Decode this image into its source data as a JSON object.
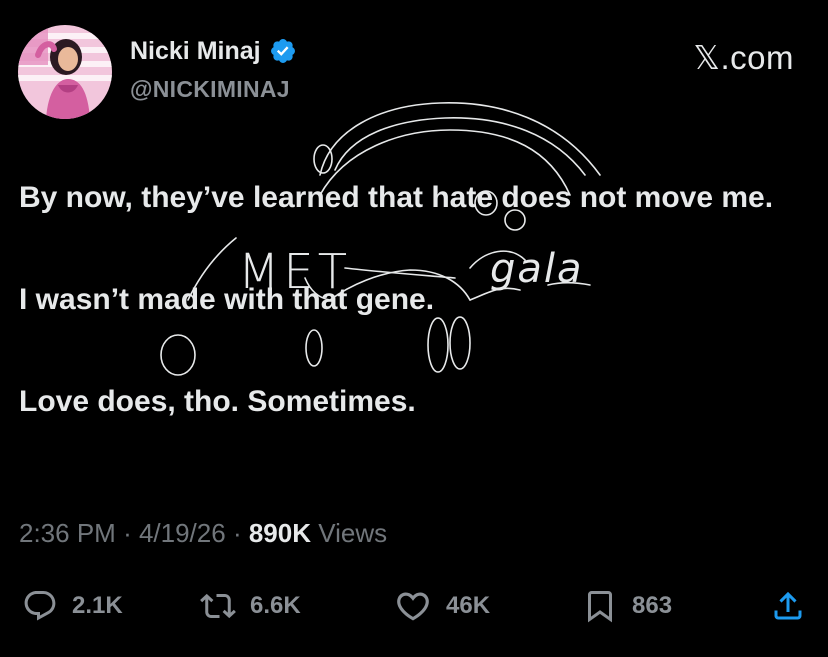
{
  "author": {
    "name": "Nicki Minaj",
    "handle": "@NICKIMINAJ",
    "verified": true
  },
  "brand": "𝕏.com",
  "tweet": {
    "line1": "By now, they’ve learned that hate does not move me.",
    "line2": "I wasn’t made with that gene.",
    "line3": "Love does, tho. Sometimes."
  },
  "meta": {
    "time": "2:36 PM",
    "date": "4/19/26",
    "views_count": "890K",
    "views_label": "Views"
  },
  "actions": {
    "replies": "2.1K",
    "reposts": "6.6K",
    "likes": "46K",
    "bookmarks": "863"
  },
  "annotation": {
    "left": "MET",
    "right": "gala"
  },
  "colors": {
    "background": "#000000",
    "text": "#e7e9ea",
    "muted": "#71767b",
    "verified": "#1d9bf0"
  }
}
